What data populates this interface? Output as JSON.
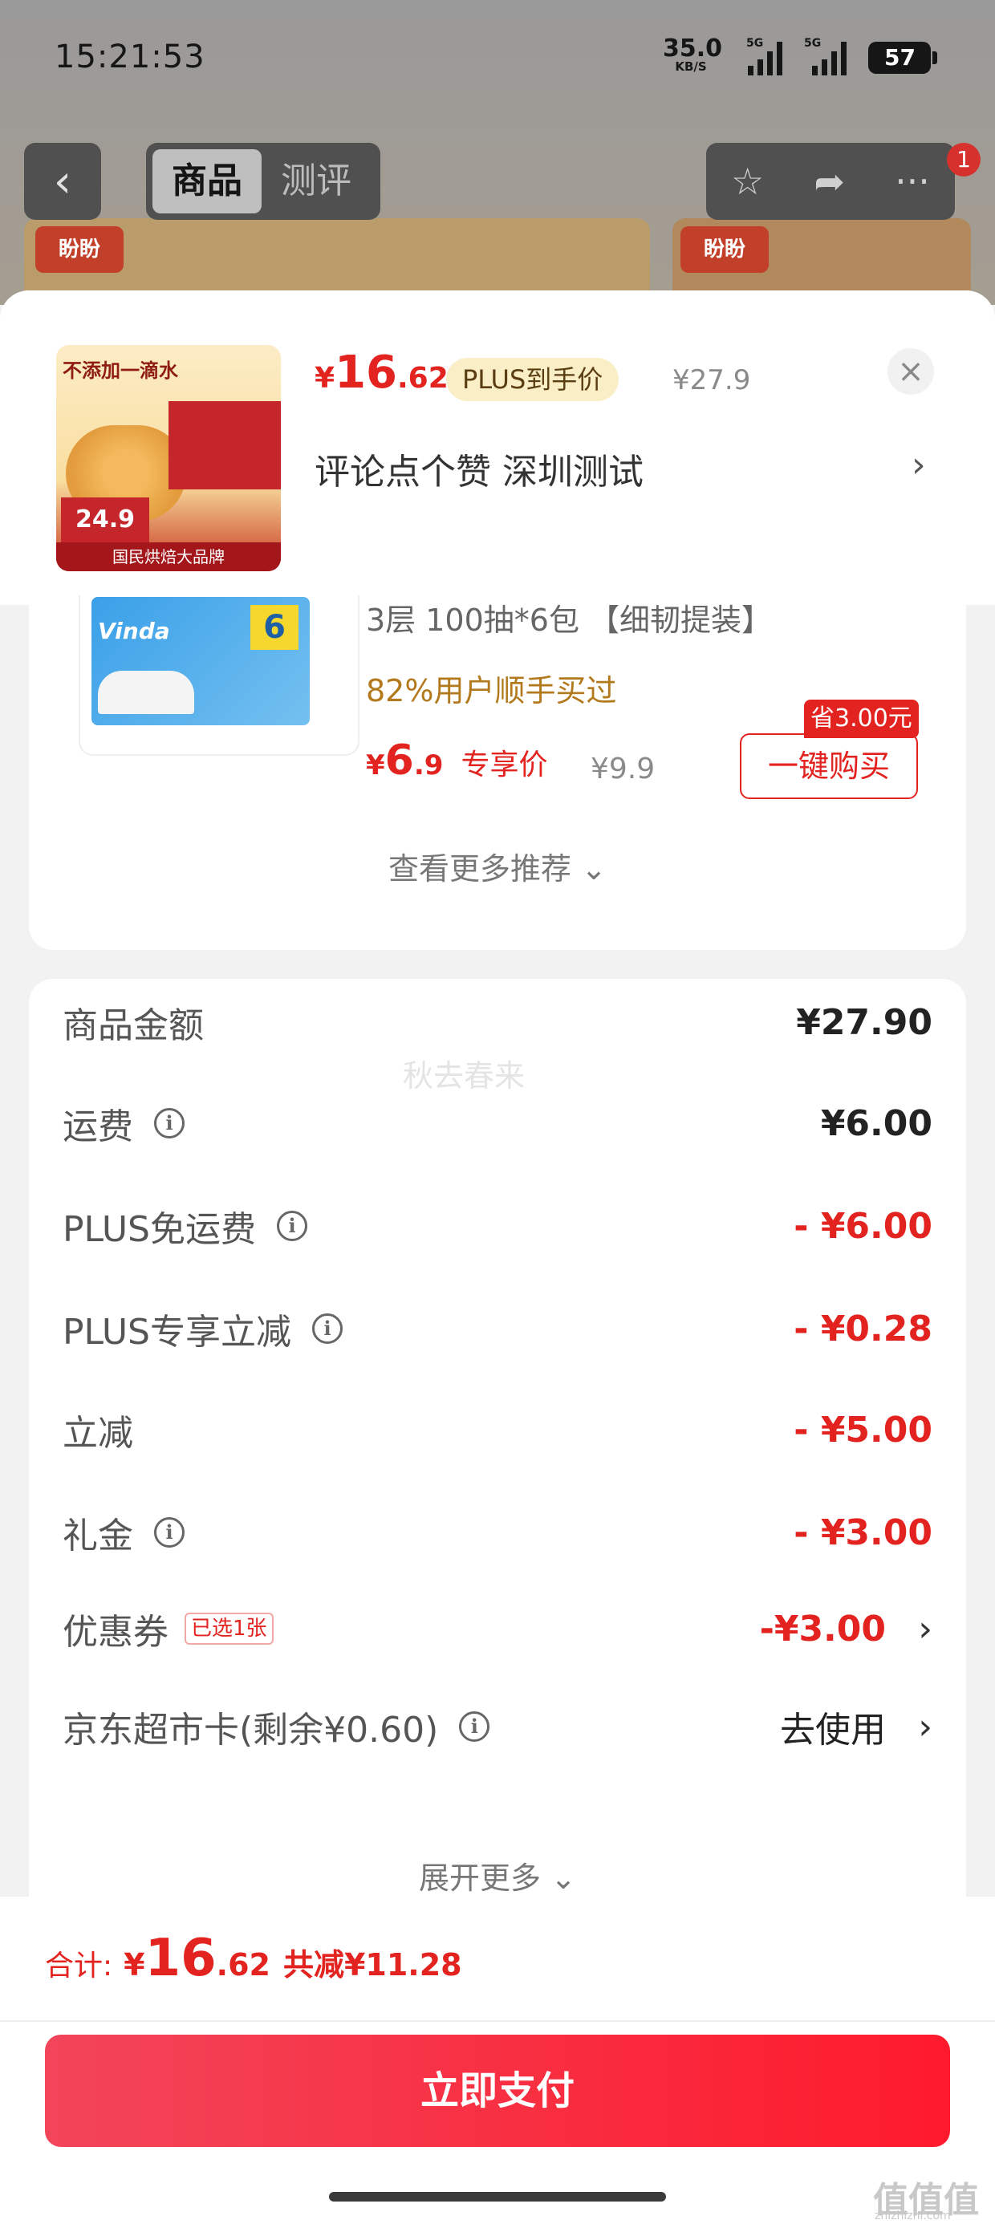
{
  "status_bar": {
    "time": "15:21:53",
    "net_speed": "35.0",
    "net_unit": "KB/S",
    "sim1": "5G",
    "sim2": "5G",
    "battery": "57"
  },
  "nav": {
    "back_icon": "chevron-left-icon",
    "tabs": [
      {
        "label": "商品",
        "active": true
      },
      {
        "label": "测评",
        "active": false
      }
    ],
    "badge": "1",
    "icons": [
      "star-icon",
      "share-icon",
      "more-icon"
    ]
  },
  "background": {
    "brand_logo": "盼盼"
  },
  "sheet": {
    "product_image": {
      "tagline": "不添加一滴水",
      "price": "24.9",
      "footer": "国民烘焙大品牌"
    },
    "price": {
      "symbol": "¥",
      "int": "16",
      "dec": ".62"
    },
    "plus_tag": "PLUS到手价",
    "original_price": "¥27.9",
    "address": "评论点个赞  深圳测试",
    "close_icon": "close-icon"
  },
  "recommendation": {
    "image_logo": "Vinda",
    "image_badge": "6",
    "title": "3层 100抽*6包 【细韧提装】",
    "bought": "82%用户顺手买过",
    "price": {
      "symbol": "¥",
      "int": "6",
      "dec": ".9",
      "tag": "专享价"
    },
    "original_price": "¥9.9",
    "save_tag": "省3.00元",
    "buy_label": "一键购买",
    "see_more": "查看更多推荐 ⌄"
  },
  "summary": {
    "watermark": "秋去春来",
    "rows": [
      {
        "label": "商品金额",
        "value": "¥27.90"
      },
      {
        "label": "运费",
        "value": "¥6.00"
      },
      {
        "label": "PLUS免运费",
        "value": "- ¥6.00"
      },
      {
        "label": "PLUS专享立减",
        "value": "- ¥0.28"
      },
      {
        "label": "立减",
        "value": "- ¥5.00"
      },
      {
        "label": "礼金",
        "value": "- ¥3.00"
      },
      {
        "label": "优惠券",
        "tag": "已选1张",
        "value": "-¥3.00"
      },
      {
        "label": "京东超市卡(剩余¥0.60)",
        "value": "去使用"
      }
    ],
    "expand_more": "展开更多 ⌄"
  },
  "footer": {
    "total_label": "合计:",
    "total": {
      "symbol": "¥",
      "int": "16",
      "dec": ".62"
    },
    "saved": "共减¥11.28",
    "pay_button": "立即支付",
    "site_mark": "值值值",
    "site_url": "zhizhizhi.com"
  },
  "colors": {
    "accent_red": "#e3231f",
    "pay_gradient_start": "#f2455a",
    "pay_gradient_end": "#fe1a2c",
    "plus_tag_bg": "#faeec7"
  }
}
